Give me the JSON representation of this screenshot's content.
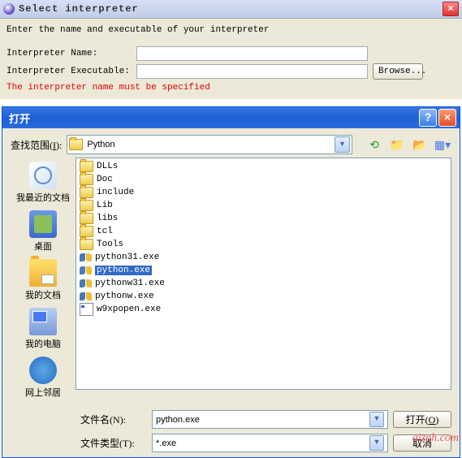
{
  "win1": {
    "title": "Select interpreter",
    "instruction": "Enter the name and executable of your interpreter",
    "name_label": "Interpreter Name:",
    "exec_label": "Interpreter Executable:",
    "name_value": "",
    "exec_value": "",
    "browse": "Browse...",
    "error": "The interpreter name must be specified"
  },
  "win2": {
    "title": "打开",
    "lookin_label": "查找范围",
    "lookin_key": "I",
    "lookin_value": "Python",
    "places": [
      {
        "label": "我最近的文档",
        "icon": "ico-recent"
      },
      {
        "label": "桌面",
        "icon": "ico-desktop"
      },
      {
        "label": "我的文档",
        "icon": "ico-docs"
      },
      {
        "label": "我的电脑",
        "icon": "ico-computer"
      },
      {
        "label": "网上邻居",
        "icon": "ico-network"
      }
    ],
    "files": [
      {
        "name": "DLLs",
        "type": "folder"
      },
      {
        "name": "Doc",
        "type": "folder"
      },
      {
        "name": "include",
        "type": "folder"
      },
      {
        "name": "Lib",
        "type": "folder"
      },
      {
        "name": "libs",
        "type": "folder"
      },
      {
        "name": "tcl",
        "type": "folder"
      },
      {
        "name": "Tools",
        "type": "folder"
      },
      {
        "name": "python31.exe",
        "type": "py"
      },
      {
        "name": "python.exe",
        "type": "py",
        "selected": true
      },
      {
        "name": "pythonw31.exe",
        "type": "py"
      },
      {
        "name": "pythonw.exe",
        "type": "py"
      },
      {
        "name": "w9xpopen.exe",
        "type": "exe"
      }
    ],
    "filename_label": "文件名",
    "filename_key": "N",
    "filename_value": "python.exe",
    "filetype_label": "文件类型",
    "filetype_key": "T",
    "filetype_value": "*.exe",
    "open_btn": "打开",
    "open_key": "O",
    "cancel_btn": "取消"
  },
  "watermark": "aiznh.com"
}
